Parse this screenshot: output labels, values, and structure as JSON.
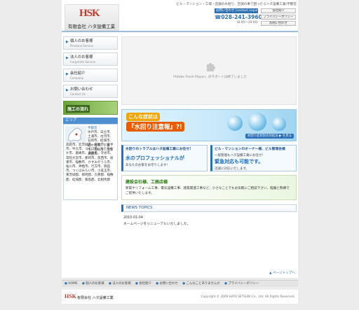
{
  "header": {
    "logo_mark": "HSK",
    "company_name": "有限会社 ハタ設備工業",
    "tagline": "ビル・マンション・工場・店舗の水廻り、空調の事で困ったらハタ設備工業(宇都宮",
    "contact_title": "お問い合わせ [contact inquiry]",
    "contact_phone": "☎028-241-3960",
    "contact_hours": "(8:00〜19:00)",
    "buttons": [
      "会社紹介",
      "プライバシーポリシー",
      "お問い合わせ"
    ]
  },
  "sidebar": {
    "items": [
      {
        "label": "個人のお客様",
        "sub": "Personal Service"
      },
      {
        "label": "法人のお客様",
        "sub": "Corporate Service"
      },
      {
        "label": "会社紹介",
        "sub": "Company"
      },
      {
        "label": "お問い合わせ",
        "sub": "Contact Us"
      }
    ],
    "flow_banner": "施工の流れ",
    "area_title": "エリア",
    "area_label": "宇都宮",
    "area_text_right": "水戸市、日立市、土浦市、古河市、石岡市、結城市、龍ケ崎市、下妻市、常総市、常陸太田市、",
    "area_text_below": "高萩市、北茨城市、笠間市、取手市、牛久市、つくば市、ひたちなか市、鹿嶋市、潮来市、守谷市、常陸大宮市、那珂市、筑西市、坂東市、稲敷市、かすみがうら市、桜川市、神栖市、行方市、鉾田市、つくばみらい市、小美玉市、東茨城郡、那珂郡、久慈郡、稲敷郡、結城郡、猿島郡、北相馬郡"
  },
  "main": {
    "flash_message": "「Adobe Flash Player」のサポートは終了しました",
    "banner": {
      "line1": "こんな症状は",
      "line2": "『水回り注意報』?!",
      "link": "水回り症状別の対処法 ▶ を見る"
    },
    "box_left": {
      "head": "水回りのトラブルはハタ設備工業にお任せ!",
      "big": "水のプロフェッショナルが",
      "sub": "あなたのお家をお守りします!"
    },
    "box_right": {
      "head": "ビル・マンションのオーナー様、ビル管理会様",
      "big_pre": "一般管理もハタ設備工業にお任せ!",
      "big": "緊急対応も可能です。",
      "sub": "迅速に対応いたします。"
    },
    "company_box": {
      "title": "建設会社様、工務店様",
      "text": "新築やリフォーム工事、電気設備工事、建築関連工事など、小さなことでもお気軽にご相談下さい。経験と熟練でご提供いたします。"
    },
    "news": {
      "heading": "NEWS TOPICS",
      "date": "2010-01-04",
      "text": "ホームページをリニューアルいたしました。"
    },
    "pagetop": "▲ ページトップへ"
  },
  "footer": {
    "nav": [
      "HOME",
      "個人のお客様",
      "法人のお客様",
      "会社紹介",
      "お問い合わせ",
      "こんなことありませんか",
      "プライバシーポリシー"
    ],
    "logo_mark": "HSK",
    "company_name": "有限会社 ハタ設備工業",
    "copyright": "Copyright © 2009 HATA SETSUBI Co., Ltd. All Rights Reserved."
  },
  "colors": {
    "accent": "#2d6fb3",
    "brand_red": "#c0392b",
    "orange": "#e85b00",
    "green": "#2f7a1a"
  }
}
